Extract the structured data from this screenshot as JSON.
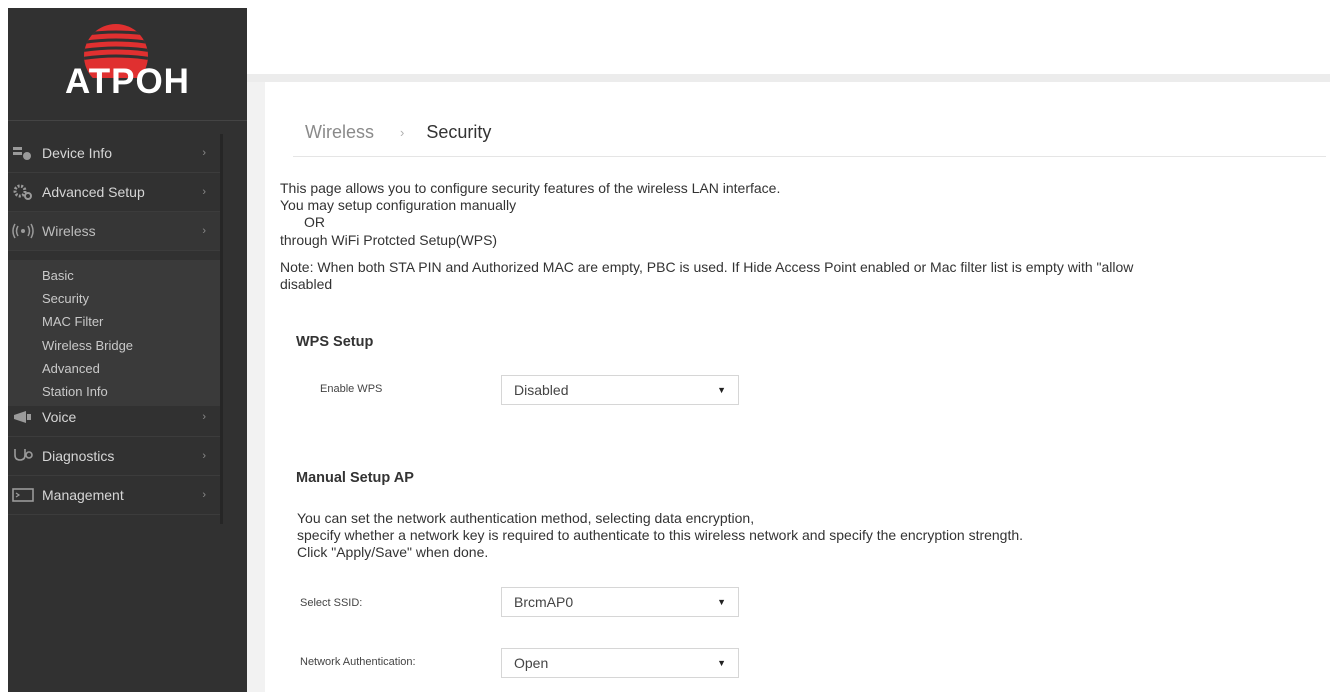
{
  "brand": {
    "logo_text": "ATPOH",
    "accent_color": "#d42a2a"
  },
  "sidebar": {
    "items": [
      {
        "label": "Device Info",
        "icon": "device-info-icon"
      },
      {
        "label": "Advanced Setup",
        "icon": "gears-icon"
      },
      {
        "label": "Wireless",
        "icon": "wireless-icon"
      },
      {
        "label": "Voice",
        "icon": "voice-icon"
      },
      {
        "label": "Diagnostics",
        "icon": "stethoscope-icon"
      },
      {
        "label": "Management",
        "icon": "monitor-icon"
      }
    ],
    "wireless_submenu": [
      "Basic",
      "Security",
      "MAC Filter",
      "Wireless Bridge",
      "Advanced",
      "Station Info"
    ],
    "chevron": "›"
  },
  "breadcrumb": {
    "parent": "Wireless",
    "separator": "›",
    "current": "Security"
  },
  "intro": {
    "lines": [
      "This page allows you to configure security features of the wireless LAN interface.",
      "You may setup configuration manually",
      "OR",
      "through WiFi Protcted Setup(WPS)",
      "Note: When both STA PIN and Authorized MAC are empty, PBC is used. If Hide Access Point enabled or Mac filter list is empty with \"allow",
      "disabled"
    ]
  },
  "wps": {
    "title": "WPS Setup",
    "enable_label": "Enable WPS",
    "enable_value": "Disabled"
  },
  "manual": {
    "title": "Manual Setup AP",
    "lines": [
      "You can set the network authentication method, selecting data encryption,",
      "specify whether a network key is required to authenticate to this wireless network and specify the encryption strength.",
      "Click \"Apply/Save\" when done."
    ],
    "ssid_label": "Select SSID:",
    "ssid_value": "BrcmAP0",
    "auth_label": "Network Authentication:",
    "auth_value": "Open"
  },
  "select_arrow": "▼"
}
